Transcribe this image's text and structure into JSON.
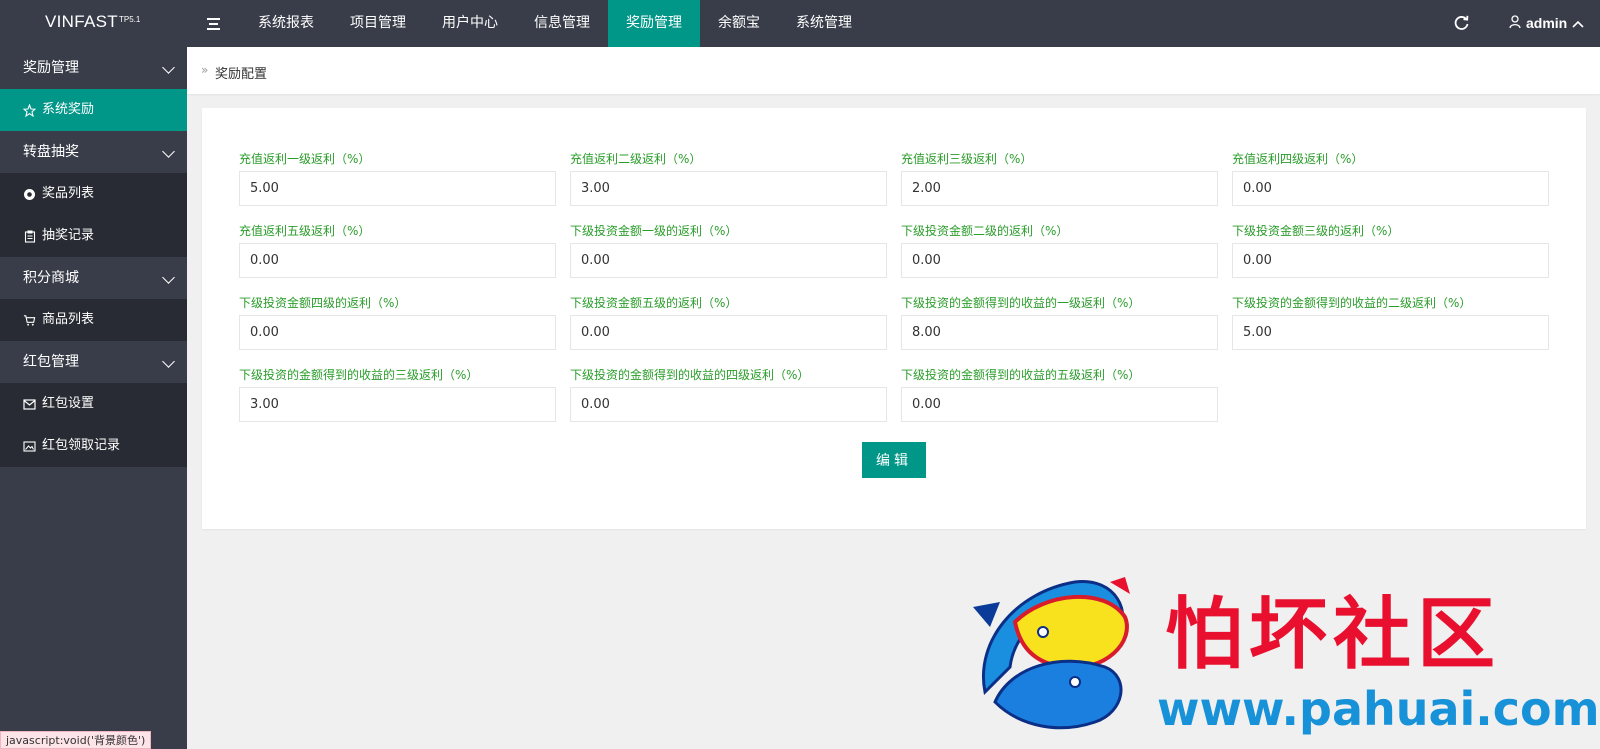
{
  "header": {
    "logo_name": "VINFAST",
    "logo_version": "TP5.1",
    "nav": [
      "系统报表",
      "项目管理",
      "用户中心",
      "信息管理",
      "奖励管理",
      "余额宝",
      "系统管理"
    ],
    "active_nav": "奖励管理",
    "user": "admin"
  },
  "sidebar": {
    "groups": [
      {
        "label": "奖励管理",
        "items": [
          {
            "label": "系统奖励",
            "icon": "star-icon",
            "active": true
          }
        ]
      },
      {
        "label": "转盘抽奖",
        "items": [
          {
            "label": "奖品列表",
            "icon": "lifebuoy-icon"
          },
          {
            "label": "抽奖记录",
            "icon": "clipboard-icon"
          }
        ]
      },
      {
        "label": "积分商城",
        "items": [
          {
            "label": "商品列表",
            "icon": "cart-icon"
          }
        ]
      },
      {
        "label": "红包管理",
        "items": [
          {
            "label": "红包设置",
            "icon": "envelope-icon"
          },
          {
            "label": "红包领取记录",
            "icon": "image-icon"
          }
        ]
      }
    ]
  },
  "breadcrumb": {
    "current": "奖励配置"
  },
  "form": {
    "fields": [
      {
        "label": "充值返利一级返利（%）",
        "value": "5.00"
      },
      {
        "label": "充值返利二级返利（%）",
        "value": "3.00"
      },
      {
        "label": "充值返利三级返利（%）",
        "value": "2.00"
      },
      {
        "label": "充值返利四级返利（%）",
        "value": "0.00"
      },
      {
        "label": "充值返利五级返利（%）",
        "value": "0.00"
      },
      {
        "label": "下级投资金额一级的返利（%）",
        "value": "0.00"
      },
      {
        "label": "下级投资金额二级的返利（%）",
        "value": "0.00"
      },
      {
        "label": "下级投资金额三级的返利（%）",
        "value": "0.00"
      },
      {
        "label": "下级投资金额四级的返利（%）",
        "value": "0.00"
      },
      {
        "label": "下级投资金额五级的返利（%）",
        "value": "0.00"
      },
      {
        "label": "下级投资的金额得到的收益的一级返利（%）",
        "value": "8.00"
      },
      {
        "label": "下级投资的金额得到的收益的二级返利（%）",
        "value": "5.00"
      },
      {
        "label": "下级投资的金额得到的收益的三级返利（%）",
        "value": "3.00"
      },
      {
        "label": "下级投资的金额得到的收益的四级返利（%）",
        "value": "0.00"
      },
      {
        "label": "下级投资的金额得到的收益的五级返利（%）",
        "value": "0.00"
      }
    ],
    "submit_label": "编辑"
  },
  "watermark": {
    "title": "怕坏社区",
    "url": "www.pahuai.com"
  },
  "status_tip": "javascript:void('背景颜色')",
  "colors": {
    "accent": "#009688",
    "header_bg": "#393d49",
    "sidebar_sub_bg": "#282b33",
    "label_green": "#2a9d2a"
  }
}
